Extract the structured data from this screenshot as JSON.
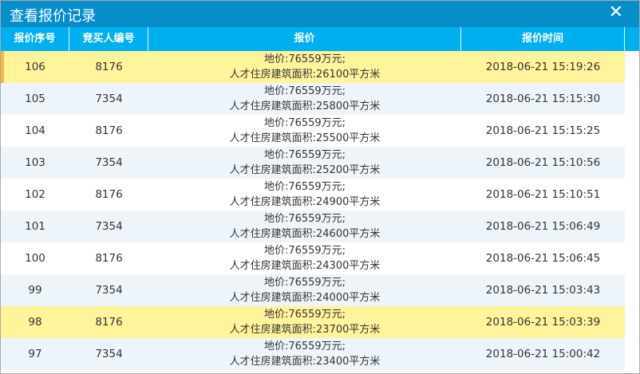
{
  "window": {
    "title": "查看报价记录",
    "close_icon": "close-icon"
  },
  "columns": [
    "报价序号",
    "竞买人编号",
    "报价",
    "报价时间"
  ],
  "rows": [
    {
      "seq": "106",
      "bidder": "8176",
      "price": "地价:76559万元;",
      "area": "人才住房建筑面积:26100平方米",
      "time": "2018-06-21 15:19:26",
      "style": "hl",
      "marked": true
    },
    {
      "seq": "105",
      "bidder": "7354",
      "price": "地价:76559万元;",
      "area": "人才住房建筑面积:25800平方米",
      "time": "2018-06-21 15:15:30",
      "style": "alt"
    },
    {
      "seq": "104",
      "bidder": "8176",
      "price": "地价:76559万元;",
      "area": "人才住房建筑面积:25500平方米",
      "time": "2018-06-21 15:15:25",
      "style": ""
    },
    {
      "seq": "103",
      "bidder": "7354",
      "price": "地价:76559万元;",
      "area": "人才住房建筑面积:25200平方米",
      "time": "2018-06-21 15:10:56",
      "style": "alt"
    },
    {
      "seq": "102",
      "bidder": "8176",
      "price": "地价:76559万元;",
      "area": "人才住房建筑面积:24900平方米",
      "time": "2018-06-21 15:10:51",
      "style": ""
    },
    {
      "seq": "101",
      "bidder": "7354",
      "price": "地价:76559万元;",
      "area": "人才住房建筑面积:24600平方米",
      "time": "2018-06-21 15:06:49",
      "style": "alt"
    },
    {
      "seq": "100",
      "bidder": "8176",
      "price": "地价:76559万元;",
      "area": "人才住房建筑面积:24300平方米",
      "time": "2018-06-21 15:06:45",
      "style": ""
    },
    {
      "seq": "99",
      "bidder": "7354",
      "price": "地价:76559万元;",
      "area": "人才住房建筑面积:24000平方米",
      "time": "2018-06-21 15:03:43",
      "style": "alt"
    },
    {
      "seq": "98",
      "bidder": "8176",
      "price": "地价:76559万元;",
      "area": "人才住房建筑面积:23700平方米",
      "time": "2018-06-21 15:03:39",
      "style": "hl"
    },
    {
      "seq": "97",
      "bidder": "7354",
      "price": "地价:76559万元;",
      "area": "人才住房建筑面积:23400平方米",
      "time": "2018-06-21 15:00:42",
      "style": "alt"
    }
  ]
}
